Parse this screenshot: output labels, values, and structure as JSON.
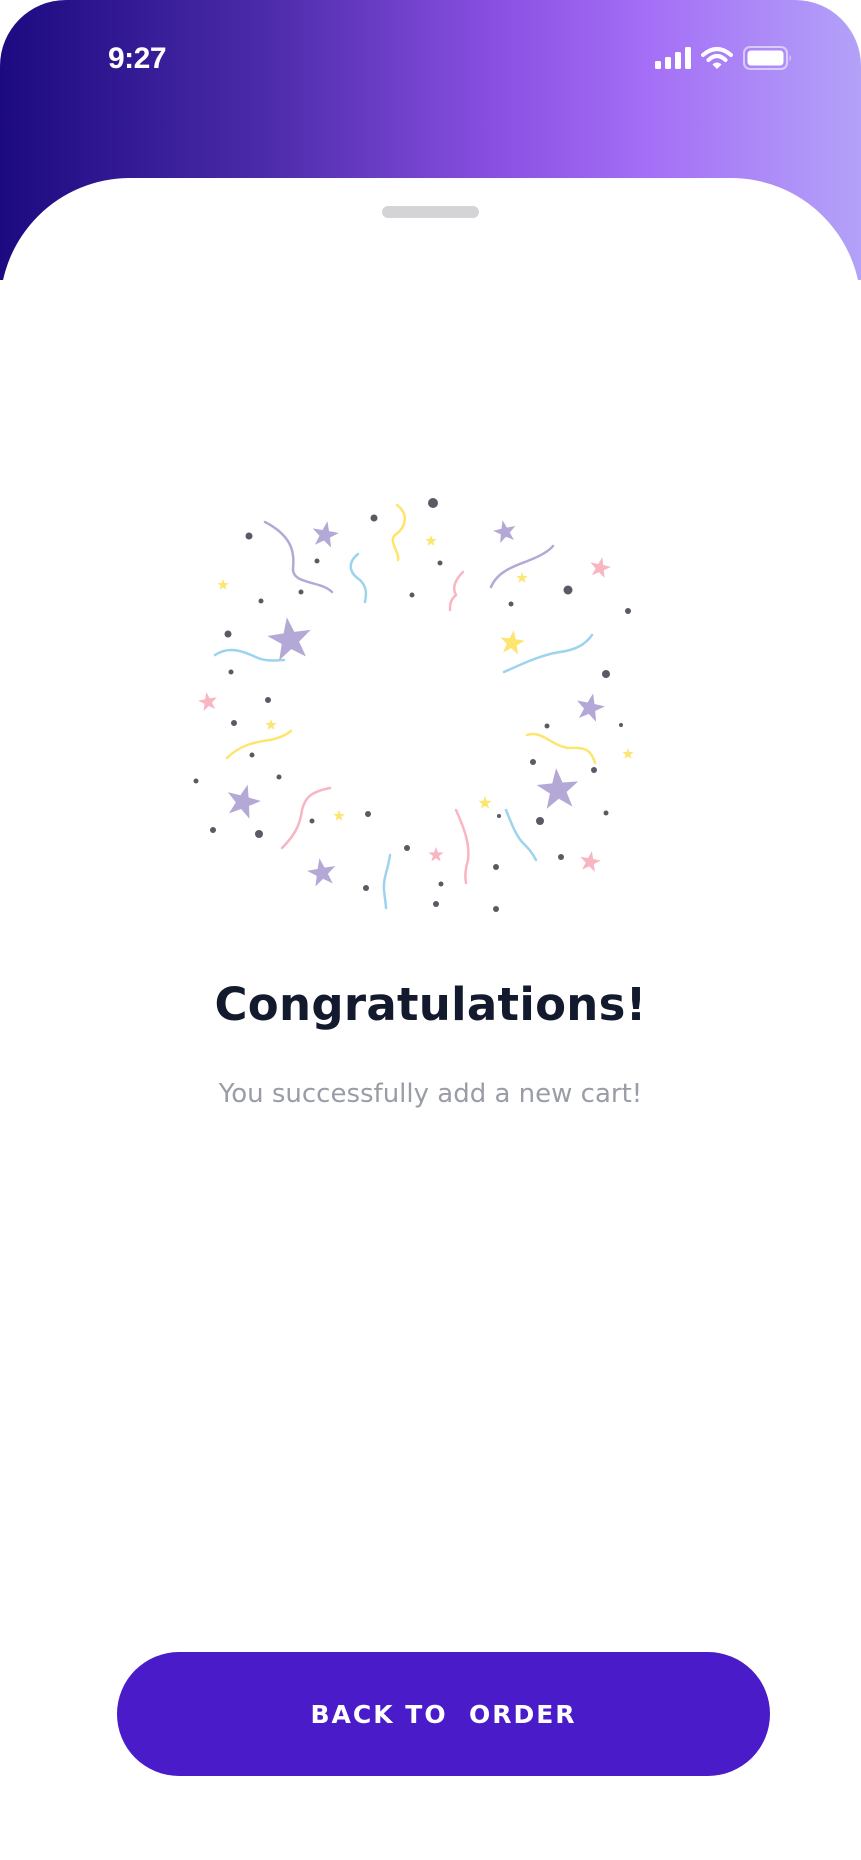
{
  "status_bar": {
    "time": "9:27",
    "icons": [
      "signal-icon",
      "wifi-icon",
      "battery-icon"
    ]
  },
  "success": {
    "title": "Congratulations!",
    "message": "You successfully add a new cart!"
  },
  "actions": {
    "back_label": "BACK TO  ORDER"
  },
  "colors": {
    "header_gradient": [
      "#1c0a80",
      "#8a50e2",
      "#a46ef6",
      "#b3a2f8"
    ],
    "button": "#4a1bc9",
    "title": "#141a2e",
    "message": "#9a9ca6",
    "confetti": [
      "#b4a9d6",
      "#fde56f",
      "#9ed3ee",
      "#f8b6c3",
      "#5a5a64"
    ]
  }
}
